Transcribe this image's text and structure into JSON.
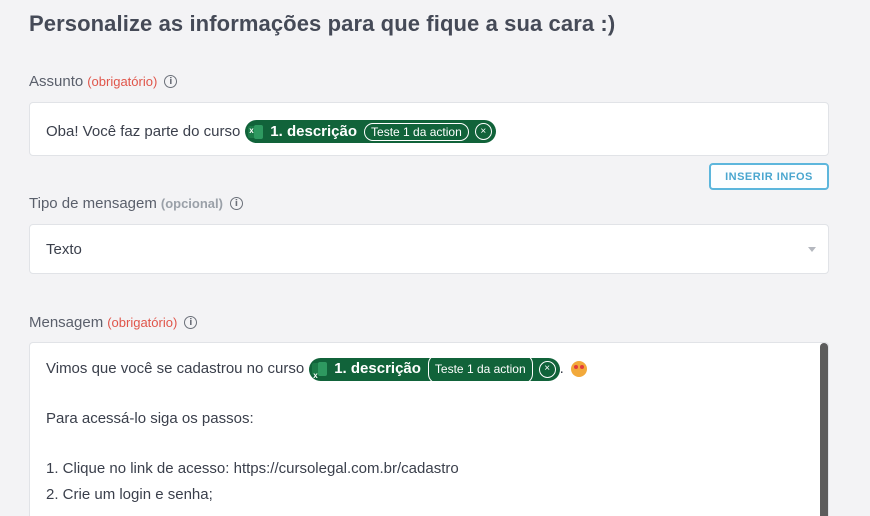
{
  "page_title": "Personalize as informações para que fique a sua cara :)",
  "subject": {
    "label": "Assunto",
    "qualifier": "(obrigatório)",
    "info_icon": "i",
    "text": "Oba! Você faz parte do curso",
    "chip": {
      "name": "1. descrição",
      "tag": "Teste 1 da action",
      "close": "×",
      "icon": "excel-icon"
    }
  },
  "insert_button": {
    "label": "INSERIR INFOS"
  },
  "message_type": {
    "label": "Tipo de mensagem",
    "qualifier": "(opcional)",
    "info_icon": "i",
    "value": "Texto"
  },
  "message": {
    "label": "Mensagem",
    "qualifier": "(obrigatório)",
    "info_icon": "i",
    "line1_text": "Vimos que você se cadastrou no curso",
    "chip": {
      "name": "1. descrição",
      "tag": "Teste 1 da action",
      "close": "×",
      "icon": "excel-icon"
    },
    "line1_suffix": ".",
    "line2": "Para acessá-lo siga os passos:",
    "step1": "1. Clique no link de acesso: https://cursolegal.com.br/cadastro",
    "step2": "2. Crie um login e senha;"
  },
  "colors": {
    "chip_bg": "#11633a",
    "required": "#e0554a",
    "button": "#4aa6cf"
  }
}
